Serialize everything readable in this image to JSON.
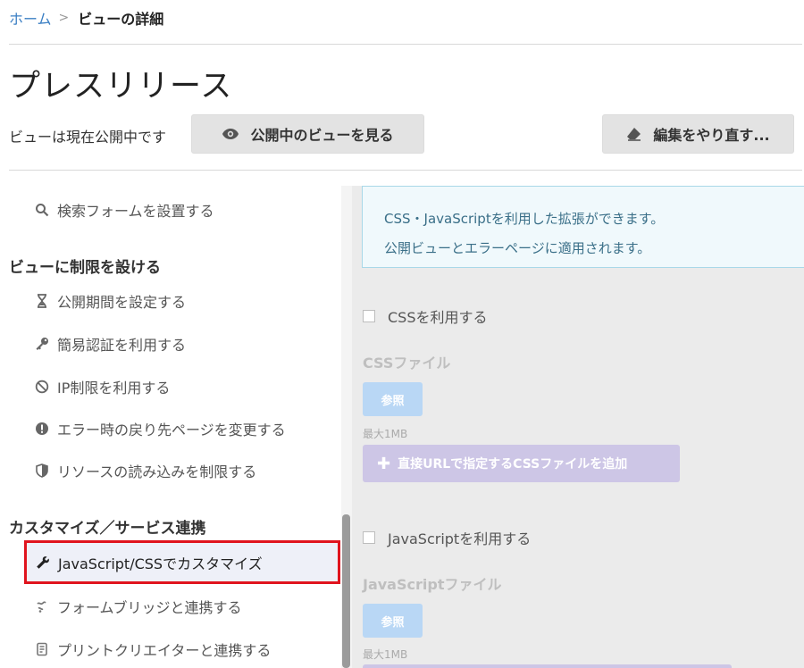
{
  "breadcrumb": {
    "home": "ホーム",
    "separator": ">",
    "current": "ビューの詳細"
  },
  "page_title": "プレスリリース",
  "status_text": "ビューは現在公開中です",
  "buttons": {
    "view_public": "公開中のビューを見る",
    "reset": "編集をやり直す..."
  },
  "sidebar": {
    "item_search_form": "検索フォームを設置する",
    "section_restrict": "ビューに制限を設ける",
    "restrict_items": [
      {
        "icon": "hourglass-icon",
        "label": "公開期間を設定する"
      },
      {
        "icon": "key-icon",
        "label": "簡易認証を利用する"
      },
      {
        "icon": "ban-icon",
        "label": "IP制限を利用する"
      },
      {
        "icon": "exclamation-circle-icon",
        "label": "エラー時の戻り先ページを変更する"
      },
      {
        "icon": "shield-icon",
        "label": "リソースの読み込みを制限する"
      }
    ],
    "section_customize": "カスタマイズ／サービス連携",
    "active_item": "JavaScript/CSSでカスタマイズ",
    "customize_items": [
      {
        "icon": "formbridge-icon",
        "label": "フォームブリッジと連携する"
      },
      {
        "icon": "document-icon",
        "label": "プリントクリエイターと連携する"
      }
    ]
  },
  "main": {
    "info_lines": [
      "CSS・JavaScriptを利用した拡張ができます。",
      "公開ビューとエラーページに適用されます。"
    ],
    "css": {
      "checkbox_label": "CSSを利用する",
      "checked": false,
      "file_label": "CSSファイル",
      "browse": "参照",
      "max_size": "最大1MB",
      "add_url": "直接URLで指定するCSSファイルを追加"
    },
    "js": {
      "checkbox_label": "JavaScriptを利用する",
      "checked": false,
      "file_label": "JavaScriptファイル",
      "browse": "参照",
      "max_size": "最大1MB"
    }
  },
  "colors": {
    "link": "#3b7fc4",
    "highlight_border": "#e0141e",
    "info_text": "#3a6f88",
    "add_button": "#cdc6e6",
    "browse_button": "#b9d7f5"
  }
}
